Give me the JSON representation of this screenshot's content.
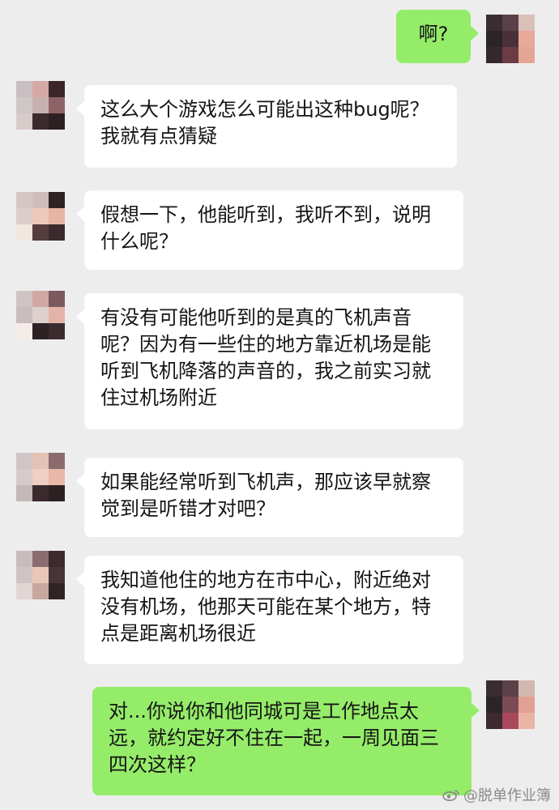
{
  "chat": {
    "messages": [
      {
        "side": "out",
        "text": "啊?"
      },
      {
        "side": "in",
        "text": "这么大个游戏怎么可能出这种bug呢？我就有点猜疑"
      },
      {
        "side": "in",
        "text": "假想一下，他能听到，我听不到，说明什么呢？"
      },
      {
        "side": "in",
        "text": "有没有可能他听到的是真的飞机声音呢？因为有一些住的地方靠近机场是能听到飞机降落的声音的，我之前实习就住过机场附近"
      },
      {
        "side": "in",
        "text": "如果能经常听到飞机声，那应该早就察觉到是听错才对吧？"
      },
      {
        "side": "in",
        "text": "我知道他住的地方在市中心，附近绝对没有机场，他那天可能在某个地方，特点是距离机场很近"
      },
      {
        "side": "out",
        "text": "对...你说你和他同城可是工作地点太远，就约定好不住在一起，一周见面三四次这样？"
      }
    ]
  },
  "watermark": {
    "text": "@脱单作业簿",
    "icon": "weibo-icon"
  },
  "colors": {
    "background": "#ededed",
    "incoming_bubble": "#ffffff",
    "outgoing_bubble": "#95ec69",
    "text": "#151515"
  }
}
